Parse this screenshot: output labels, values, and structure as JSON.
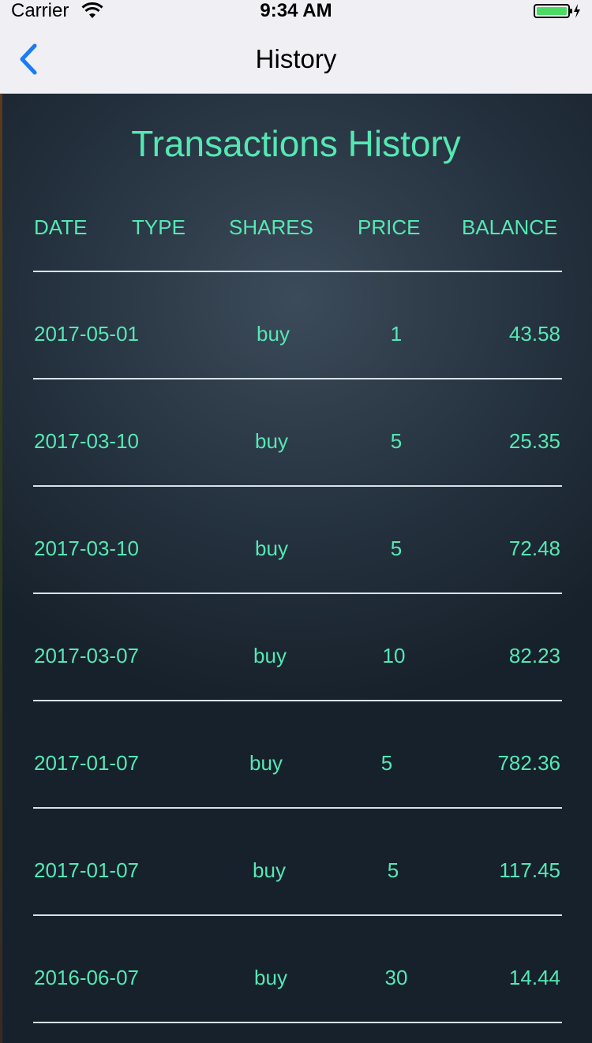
{
  "status_bar": {
    "carrier": "Carrier",
    "time": "9:34 AM"
  },
  "nav": {
    "title": "History"
  },
  "page": {
    "title": "Transactions History"
  },
  "table": {
    "headers": [
      "DATE",
      "TYPE",
      "SHARES",
      "PRICE",
      "BALANCE"
    ],
    "rows": [
      {
        "date": "2017-05-01",
        "type": "buy",
        "price": "1",
        "balance": "43.58"
      },
      {
        "date": "2017-03-10",
        "type": "buy",
        "price": "5",
        "balance": "25.35"
      },
      {
        "date": "2017-03-10",
        "type": "buy",
        "price": "5",
        "balance": "72.48"
      },
      {
        "date": "2017-03-07",
        "type": "buy",
        "price": "10",
        "balance": "82.23"
      },
      {
        "date": "2017-01-07",
        "type": "buy",
        "price": "5",
        "balance": "782.36"
      },
      {
        "date": "2017-01-07",
        "type": "buy",
        "price": "5",
        "balance": "117.45"
      },
      {
        "date": "2016-06-07",
        "type": "buy",
        "price": "30",
        "balance": "14.44"
      }
    ]
  },
  "colors": {
    "accent": "#55e8b4",
    "nav_back": "#1a7cf5"
  }
}
